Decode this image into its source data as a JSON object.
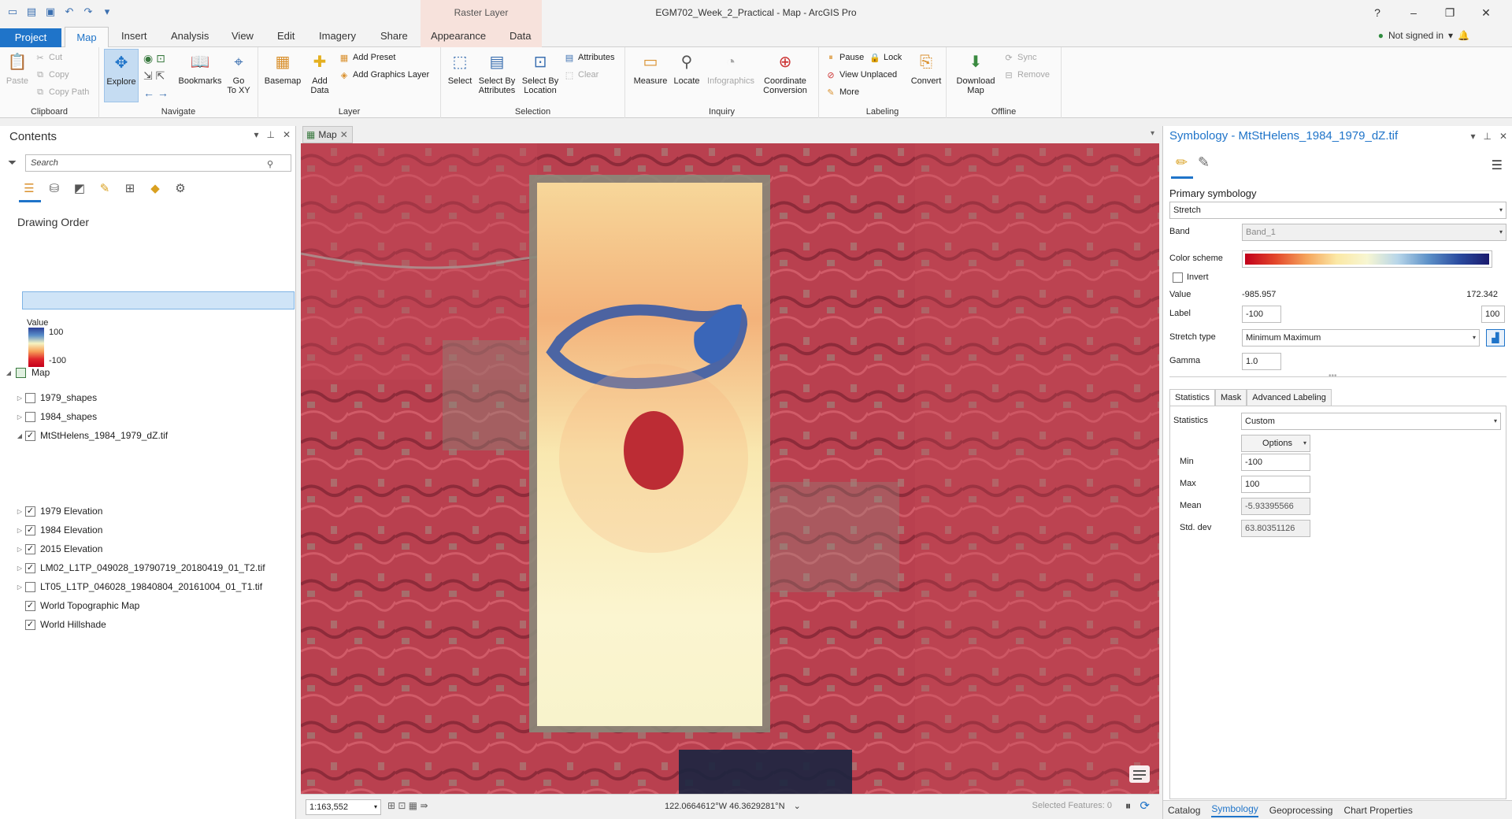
{
  "window": {
    "title": "EGM702_Week_2_Practical - Map - ArcGIS Pro",
    "context_tab_group": "Raster Layer",
    "signin": "Not signed in",
    "controls": [
      "?",
      "–",
      "❐",
      "✕"
    ]
  },
  "tabs": {
    "project": "Project",
    "map": "Map",
    "insert": "Insert",
    "analysis": "Analysis",
    "view": "View",
    "edit": "Edit",
    "imagery": "Imagery",
    "share": "Share",
    "appearance": "Appearance",
    "data": "Data"
  },
  "ribbon": {
    "clipboard": {
      "label": "Clipboard",
      "paste": "Paste",
      "cut": "Cut",
      "copy": "Copy",
      "copy_path": "Copy Path"
    },
    "navigate": {
      "label": "Navigate",
      "explore": "Explore",
      "bookmarks": "Bookmarks",
      "goto1": "Go",
      "goto2": "To XY"
    },
    "layer": {
      "label": "Layer",
      "basemap": "Basemap",
      "add_data1": "Add",
      "add_data2": "Data",
      "add_preset": "Add Preset",
      "add_graphics": "Add Graphics Layer"
    },
    "selection": {
      "label": "Selection",
      "select": "Select",
      "sba1": "Select By",
      "sba2": "Attributes",
      "sbl1": "Select By",
      "sbl2": "Location",
      "attributes": "Attributes",
      "clear": "Clear"
    },
    "inquiry": {
      "label": "Inquiry",
      "measure": "Measure",
      "locate": "Locate",
      "infographics": "Infographics",
      "coord1": "Coordinate",
      "coord2": "Conversion"
    },
    "labeling": {
      "label": "Labeling",
      "pause": "Pause",
      "lock": "Lock",
      "view_unplaced": "View Unplaced",
      "more": "More",
      "convert": "Convert"
    },
    "offline": {
      "label": "Offline",
      "download1": "Download",
      "download2": "Map",
      "sync": "Sync",
      "remove": "Remove"
    }
  },
  "contents": {
    "title": "Contents",
    "search_placeholder": "Search",
    "drawing_order": "Drawing Order",
    "map_label": "Map",
    "layers": [
      {
        "name": "1979_shapes",
        "checked": false
      },
      {
        "name": "1984_shapes",
        "checked": false
      },
      {
        "name": "MtStHelens_1984_1979_dZ.tif",
        "checked": true
      },
      {
        "name": "1979 Elevation",
        "checked": true
      },
      {
        "name": "1984 Elevation",
        "checked": true
      },
      {
        "name": "2015 Elevation",
        "checked": true
      },
      {
        "name": "LM02_L1TP_049028_19790719_20180419_01_T2.tif",
        "checked": true
      },
      {
        "name": "LT05_L1TP_046028_19840804_20161004_01_T1.tif",
        "checked": false
      },
      {
        "name": "World Topographic Map",
        "checked": true
      },
      {
        "name": "World Hillshade",
        "checked": true
      }
    ],
    "legend": {
      "title": "Value",
      "max": "100",
      "min": "-100"
    }
  },
  "map": {
    "tab_label": "Map",
    "scale": "1:163,552",
    "coordinates": "122.0664612°W 46.3629281°N",
    "selected_features": "Selected Features: 0"
  },
  "symbology": {
    "title": "Symbology - MtStHelens_1984_1979_dZ.tif",
    "primary": "Primary symbology",
    "renderer": "Stretch",
    "band_label": "Band",
    "band": "Band_1",
    "color_scheme_label": "Color scheme",
    "invert_label": "Invert",
    "value_label": "Value",
    "value_min": "-985.957",
    "value_max": "172.342",
    "label_label": "Label",
    "label_min": "-100",
    "label_max": "100",
    "stretch_type_label": "Stretch type",
    "stretch_type": "Minimum Maximum",
    "gamma_label": "Gamma",
    "gamma": "1.0",
    "tabs": [
      "Statistics",
      "Mask",
      "Advanced Labeling"
    ],
    "statistics_label": "Statistics",
    "statistics": "Custom",
    "options": "Options",
    "min_label": "Min",
    "min": "-100",
    "max_label": "Max",
    "max": "100",
    "mean_label": "Mean",
    "mean": "-5.93395566",
    "std_label": "Std. dev",
    "std": "63.80351126",
    "footer_tabs": [
      "Catalog",
      "Symbology",
      "Geoprocessing",
      "Chart Properties"
    ]
  }
}
